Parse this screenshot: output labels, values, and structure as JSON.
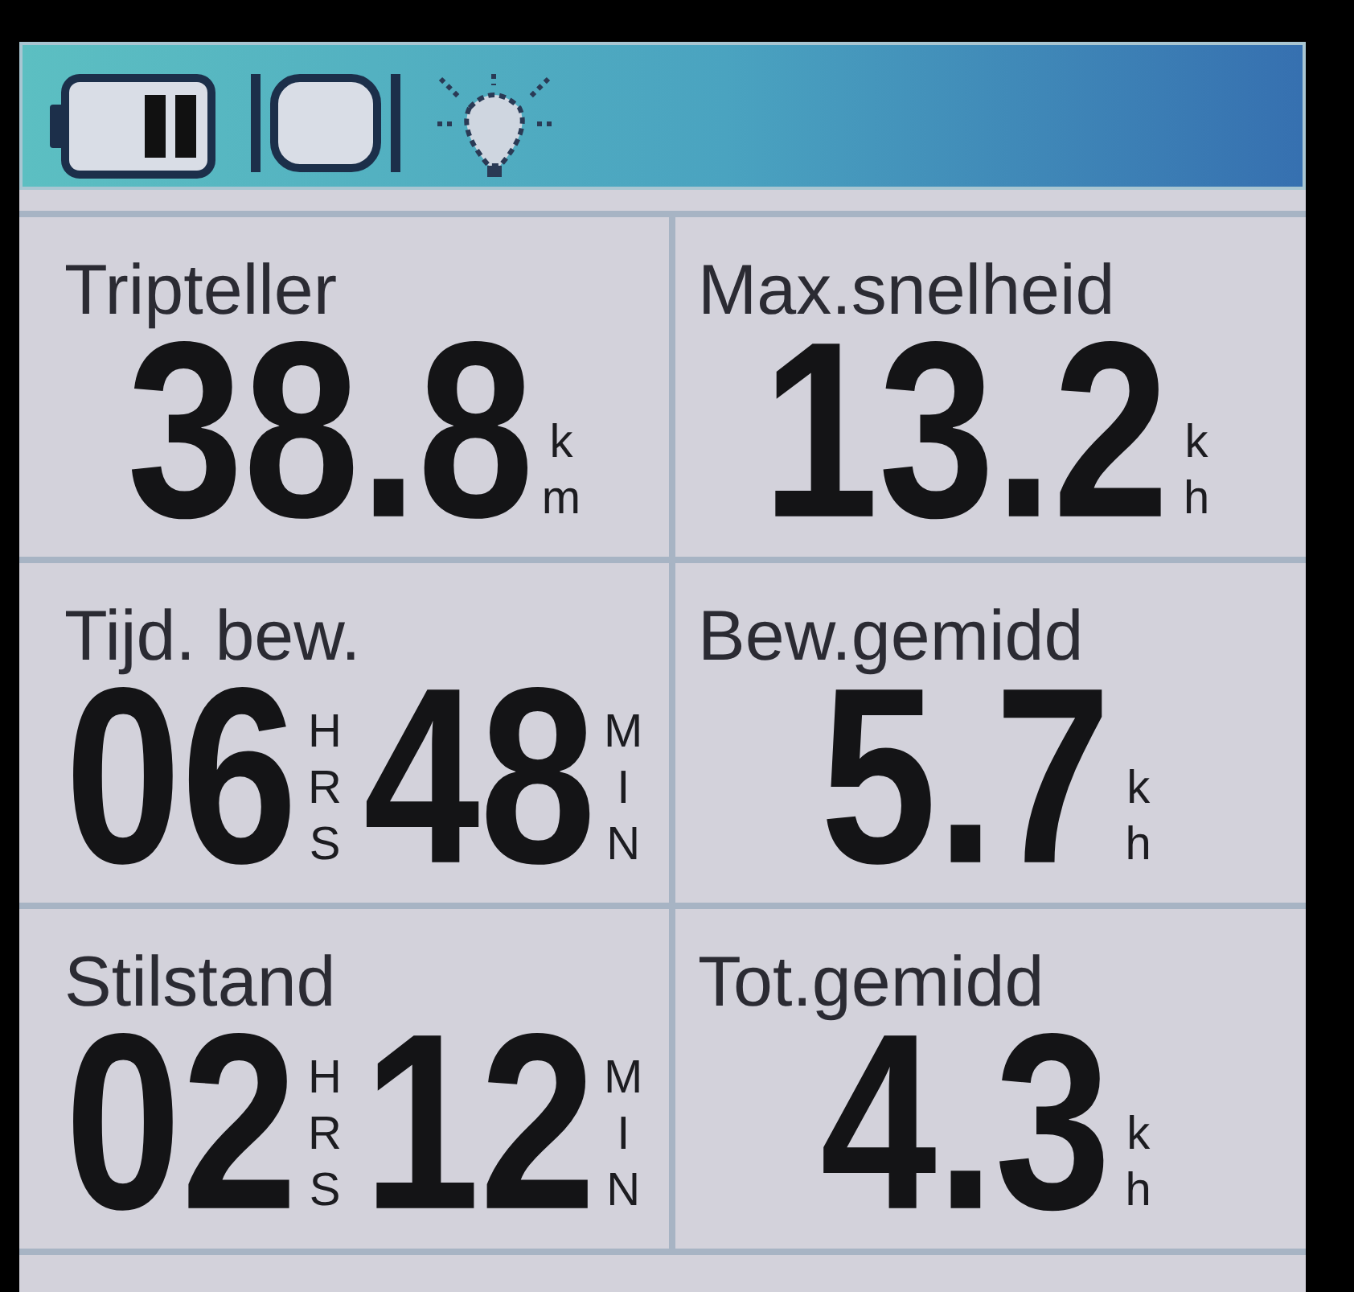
{
  "fields": [
    {
      "label": "Tripteller",
      "readings": [
        {
          "value": "38.8",
          "unit": "km"
        }
      ]
    },
    {
      "label": "Max.snelheid",
      "readings": [
        {
          "value": "13.2",
          "unit": "kh"
        }
      ]
    },
    {
      "label": "Tijd. bew.",
      "readings": [
        {
          "value": "06",
          "unit": "HRS"
        },
        {
          "value": "48",
          "unit": "MIN"
        }
      ]
    },
    {
      "label": "Bew.gemidd",
      "readings": [
        {
          "value": "5.7",
          "unit": "kh"
        }
      ]
    },
    {
      "label": "Stilstand",
      "readings": [
        {
          "value": "02",
          "unit": "HRS"
        },
        {
          "value": "12",
          "unit": "MIN"
        }
      ]
    },
    {
      "label": "Tot.gemidd",
      "readings": [
        {
          "value": "4.3",
          "unit": "kh"
        }
      ]
    }
  ]
}
